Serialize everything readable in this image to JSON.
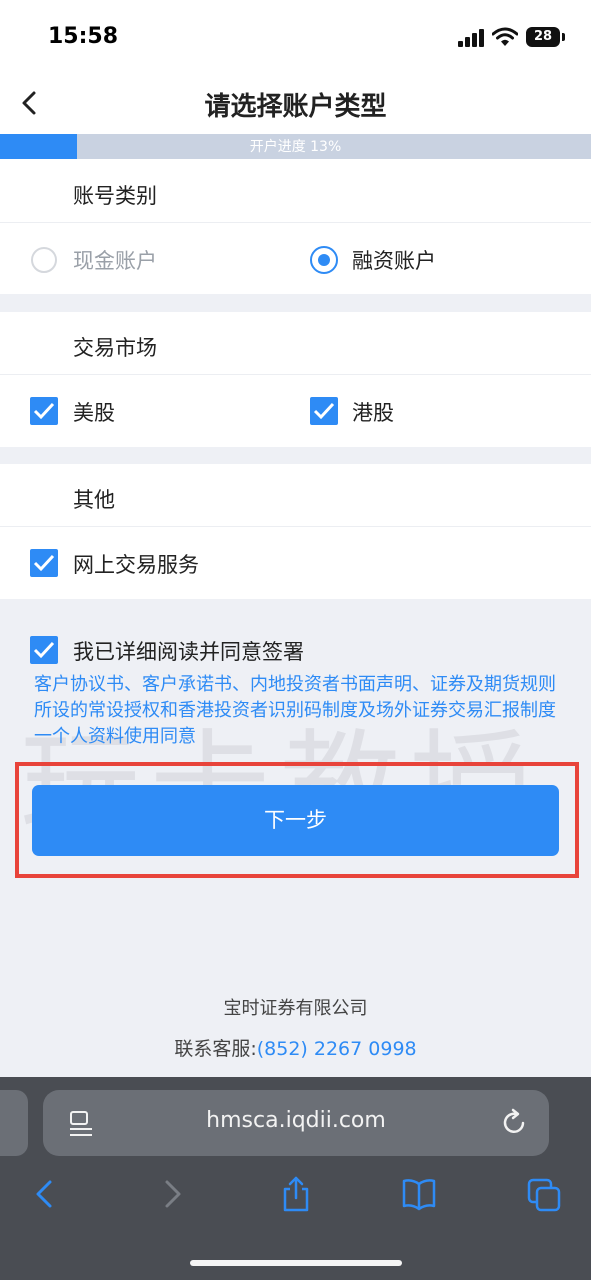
{
  "status_bar": {
    "time": "15:58",
    "battery": "28"
  },
  "header": {
    "title": "请选择账户类型"
  },
  "progress": {
    "label": "开户进度 13%",
    "value": 0.13
  },
  "account_category": {
    "title": "账号类别",
    "options": [
      {
        "label": "现金账户",
        "selected": false
      },
      {
        "label": "融资账户",
        "selected": true
      }
    ]
  },
  "market": {
    "title": "交易市场",
    "options": [
      {
        "label": "美股",
        "checked": true
      },
      {
        "label": "港股",
        "checked": true
      }
    ]
  },
  "other": {
    "title": "其他",
    "options": [
      {
        "label": "网上交易服务",
        "checked": true
      }
    ]
  },
  "agreement": {
    "label": "我已详细阅读并同意签署",
    "checked": true,
    "documents": "客户协议书、客户承诺书、内地投资者书面声明、证券及期货规则所设的常设授权和香港投资者识别码制度及场外证券交易汇报制度一个人资料使用同意"
  },
  "watermark": "玩卡教授",
  "next_button": "下一步",
  "footer": {
    "company": "宝时证券有限公司",
    "service_label": "联系客服:",
    "phone": "(852) 2267 0998"
  },
  "browser": {
    "url": "hmsca.iqdii.com"
  },
  "colors": {
    "accent": "#2e8bf5",
    "highlight": "#e8433a"
  }
}
